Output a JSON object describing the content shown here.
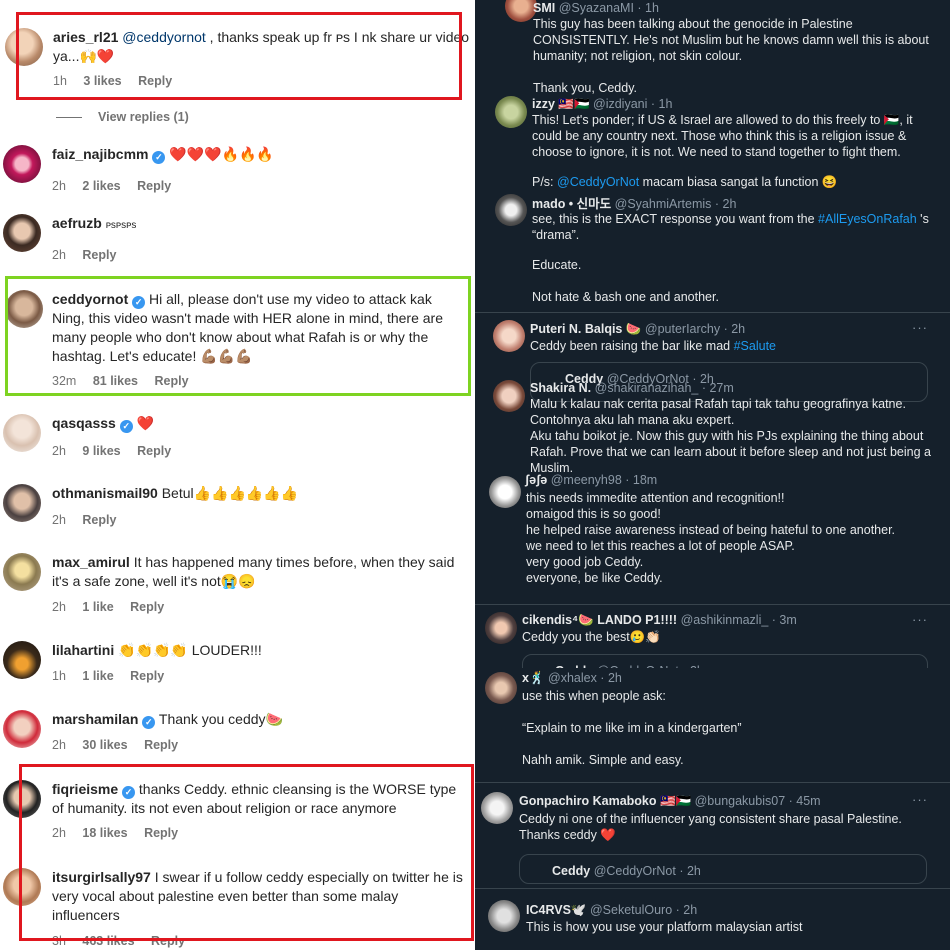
{
  "instagram": {
    "comments": [
      {
        "user": "aries_rl21",
        "verified": false,
        "mention": "@ceddyornot",
        "text": " , thanks speak up fr ᴘѕ I nk share ur video ya...🙌❤️",
        "time": "1h",
        "likes": "3 likes",
        "reply": "Reply"
      },
      {
        "user": "faiz_najibcmm",
        "verified": true,
        "text": "❤️❤️❤️🔥🔥🔥",
        "time": "2h",
        "likes": "2 likes",
        "reply": "Reply"
      },
      {
        "user": "aefruzb",
        "verified": false,
        "text": "ᴘѕᴘѕᴘѕ",
        "time": "2h",
        "likes": "",
        "reply": "Reply"
      },
      {
        "user": "ceddyornot",
        "verified": true,
        "text": "Hi all, please don't use my video to attack kak Ning, this video wasn't made with HER alone in mind, there are many people who don't know about what Rafah is or why the hashtag. Let's educate! 💪🏽💪🏽💪🏽",
        "time": "32m",
        "likes": "81 likes",
        "reply": "Reply"
      },
      {
        "user": "qasqasss",
        "verified": true,
        "text": "❤️",
        "time": "2h",
        "likes": "9 likes",
        "reply": "Reply"
      },
      {
        "user": "othmanismail90",
        "verified": false,
        "text": "Betul👍👍👍👍👍👍",
        "time": "2h",
        "likes": "",
        "reply": "Reply"
      },
      {
        "user": "max_amirul",
        "verified": false,
        "text": "It has happened many times before, when they said it's a safe zone, well it's not😭😞",
        "time": "2h",
        "likes": "1 like",
        "reply": "Reply"
      },
      {
        "user": "lilahartini",
        "verified": false,
        "text": "👏👏👏👏 LOUDER!!!",
        "time": "1h",
        "likes": "1 like",
        "reply": "Reply"
      },
      {
        "user": "marshamilan",
        "verified": true,
        "text": "Thank you ceddy🍉",
        "time": "2h",
        "likes": "30 likes",
        "reply": "Reply"
      },
      {
        "user": "fiqrieisme",
        "verified": true,
        "text": "thanks Ceddy. ethnic cleansing is the WORSE type of humanity. its not even about religion or race anymore",
        "time": "2h",
        "likes": "18 likes",
        "reply": "Reply"
      },
      {
        "user": "itsurgirlsally97",
        "verified": false,
        "text": "I swear if u follow ceddy especially on twitter he is very vocal about palestine even better than some malay influencers",
        "time": "3h",
        "likes": "463 likes",
        "reply": "Reply"
      }
    ],
    "view_replies": "View replies (1)"
  },
  "twitter": {
    "tweets": [
      {
        "name": "SMI",
        "handle": "@SyazanaMI · 1h",
        "text": "This guy has been talking about the genocide in Palestine CONSISTENTLY. He's not Muslim but he knows damn well this is about humanity; not religion, not skin colour.\n\nThank you, Ceddy."
      },
      {
        "name": "izzy 🇲🇾🇵🇸",
        "handle": "@izdiyani · 1h",
        "text": "This! Let's ponder; if US & Israel are allowed to do this freely to 🇵🇸, it could be any country next. Those who think this is a religion issue & choose to ignore, it is not. We need to stand together to fight them.",
        "ps_prefix": "P/s: ",
        "ps_mention": "@CeddyOrNot",
        "ps_suffix": " macam biasa sangat la function 😆"
      },
      {
        "name": "mado • 신마도",
        "handle": "@SyahmiArtemis · 2h",
        "text_pre": "see, this is the EXACT response you want from the ",
        "hashtag": "#AllEyesOnRafah",
        "text_post": " 's “drama”.",
        "text2": "Educate.\n\nNot hate & bash one and another."
      },
      {
        "name": "Puteri N. Balqis 🍉",
        "handle": "@puterIarchy · 2h",
        "text_pre": "Ceddy been raising the bar like mad ",
        "hashtag": "#Salute",
        "quote_name": "Ceddy",
        "quote_handle": "@CeddyOrNot · 2h"
      },
      {
        "name": "Shakira N.",
        "handle": "@shakiranazihah_ · 27m",
        "text": "Malu k kalau nak cerita pasal Rafah tapi tak tahu geografinya katne. Contohnya aku lah mana aku expert.\nAku tahu boikot je. Now this guy with his PJs explaining the thing about Rafah. Prove that we can learn about it before sleep and not just being a Muslim."
      },
      {
        "name": "ʃəʃə",
        "handle": "@meenyh98 · 18m",
        "text": "this needs immedite attention and recognition!!\nomaigod this is so good!\nhe helped raise awareness instead of being hateful to one another.\nwe need to let this reaches a lot of people ASAP.\nvery good job Ceddy.\neveryone, be like Ceddy."
      },
      {
        "name": "cikendis⁴🍉 LANDO P1!!!!",
        "handle": "@ashikinmazli_ · 3m",
        "text": "Ceddy you the best🥲👏🏻",
        "quote_name": "Ceddy",
        "quote_handle": "@CeddyOrNot · 2h"
      },
      {
        "name": "x🕺",
        "handle": "@xhalex · 2h",
        "text": "use this when people ask:\n\n“Explain to me like im in a kindergarten”\n\nNahh amik. Simple and easy."
      },
      {
        "name": "Gonpachiro Kamaboko 🇲🇾🇵🇸",
        "handle": "@bungakubis07 · 45m",
        "text": "Ceddy ni one of the influencer yang consistent share pasal Palestine. Thanks ceddy ❤️",
        "quote_name": "Ceddy",
        "quote_handle": "@CeddyOrNot · 2h"
      },
      {
        "name": "IC4RVS🕊️",
        "handle": "@SeketulOuro · 2h",
        "text": "This is how you use your platform malaysian artist"
      }
    ],
    "more": "···"
  },
  "colors": {
    "highlight_red": "#e0171f",
    "highlight_green": "#7ed321",
    "twitter_bg": "#15202b",
    "link_blue": "#1d9bf0"
  }
}
